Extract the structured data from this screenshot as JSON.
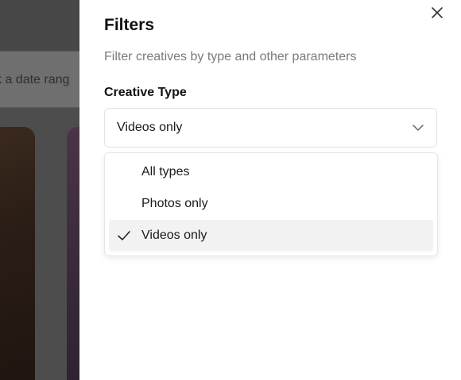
{
  "background": {
    "date_range_partial": "k a date rang"
  },
  "panel": {
    "title": "Filters",
    "subtitle": "Filter creatives by type and other parameters",
    "close_icon": "close-icon"
  },
  "creative_type": {
    "label": "Creative Type",
    "selected": "Videos only",
    "options": [
      {
        "label": "All types",
        "selected": false
      },
      {
        "label": "Photos only",
        "selected": false
      },
      {
        "label": "Videos only",
        "selected": true
      }
    ]
  },
  "colors": {
    "overlay": "#4d4d4d",
    "selected_option_bg": "#f2f2f2",
    "text_primary": "#111111",
    "text_muted": "#7a7a7a"
  }
}
